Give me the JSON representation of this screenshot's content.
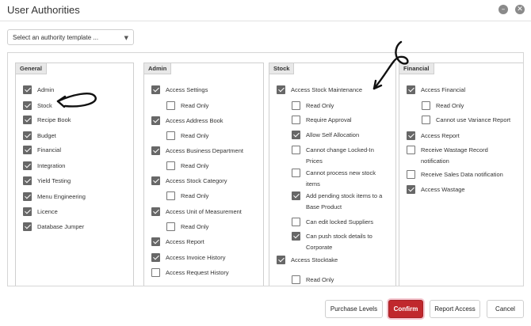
{
  "window": {
    "title": "User Authorities",
    "minimize_icon": "minimize-icon",
    "close_icon": "close-icon"
  },
  "template_select": {
    "value": "Select an authority template ...",
    "icon": "chevron-down-icon"
  },
  "columns": [
    {
      "title": "General",
      "items": [
        {
          "label": "Admin",
          "checked": true,
          "indent": false
        },
        {
          "label": "Stock",
          "checked": true,
          "indent": false
        },
        {
          "label": "Recipe Book",
          "checked": true,
          "indent": false
        },
        {
          "label": "Budget",
          "checked": true,
          "indent": false
        },
        {
          "label": "Financial",
          "checked": true,
          "indent": false
        },
        {
          "label": "Integration",
          "checked": true,
          "indent": false
        },
        {
          "label": "Yield Testing",
          "checked": true,
          "indent": false
        },
        {
          "label": "Menu Engineering",
          "checked": true,
          "indent": false
        },
        {
          "label": "Licence",
          "checked": true,
          "indent": false
        },
        {
          "label": "Database Jumper",
          "checked": true,
          "indent": false
        }
      ]
    },
    {
      "title": "Admin",
      "items": [
        {
          "label": "Access Settings",
          "checked": true,
          "indent": false
        },
        {
          "label": "Read Only",
          "checked": false,
          "indent": true
        },
        {
          "label": "Access Address Book",
          "checked": true,
          "indent": false
        },
        {
          "label": "Read Only",
          "checked": false,
          "indent": true
        },
        {
          "label": "Access Business Department",
          "checked": true,
          "indent": false
        },
        {
          "label": "Read Only",
          "checked": false,
          "indent": true
        },
        {
          "label": "Access Stock Category",
          "checked": true,
          "indent": false
        },
        {
          "label": "Read Only",
          "checked": false,
          "indent": true
        },
        {
          "label": "Access Unit of Measurement",
          "checked": true,
          "indent": false
        },
        {
          "label": "Read Only",
          "checked": false,
          "indent": true
        },
        {
          "label": "Access Report",
          "checked": true,
          "indent": false
        },
        {
          "label": "Access Invoice History",
          "checked": true,
          "indent": false
        },
        {
          "label": "Access Request History",
          "checked": false,
          "indent": false
        }
      ]
    },
    {
      "title": "Stock",
      "items": [
        {
          "label": "Access Stock Maintenance",
          "checked": true,
          "indent": false
        },
        {
          "label": "Read Only",
          "checked": false,
          "indent": true
        },
        {
          "label": "Require Approval",
          "checked": false,
          "indent": true
        },
        {
          "label": "Allow Self Allocation",
          "checked": true,
          "indent": true
        },
        {
          "label": "Cannot change Locked-In Prices",
          "checked": false,
          "indent": true
        },
        {
          "label": "Cannot process new stock items",
          "checked": false,
          "indent": true
        },
        {
          "label": "Add pending stock items to a Base Product",
          "checked": true,
          "indent": true
        },
        {
          "label": "Can edit locked Suppliers",
          "checked": false,
          "indent": true
        },
        {
          "label": "Can push stock details to Corporate",
          "checked": true,
          "indent": true
        },
        {
          "label": "Access Stocktake",
          "checked": true,
          "indent": false
        },
        {
          "label": "Read Only",
          "checked": false,
          "indent": true
        }
      ]
    },
    {
      "title": "Financial",
      "items": [
        {
          "label": "Access Financial",
          "checked": true,
          "indent": false
        },
        {
          "label": "Read Only",
          "checked": false,
          "indent": true
        },
        {
          "label": "Cannot use Variance Report",
          "checked": false,
          "indent": true
        },
        {
          "label": "Access Report",
          "checked": true,
          "indent": false
        },
        {
          "label": "Receive Wastage Record notification",
          "checked": false,
          "indent": false
        },
        {
          "label": "Receive Sales Data notification",
          "checked": false,
          "indent": false
        },
        {
          "label": "Access Wastage",
          "checked": true,
          "indent": false
        }
      ]
    }
  ],
  "footer": {
    "purchase_levels": "Purchase Levels",
    "confirm": "Confirm",
    "report_access": "Report Access",
    "cancel": "Cancel"
  },
  "colors": {
    "confirm_bg": "#c0282d",
    "checkbox_on": "#676767"
  }
}
